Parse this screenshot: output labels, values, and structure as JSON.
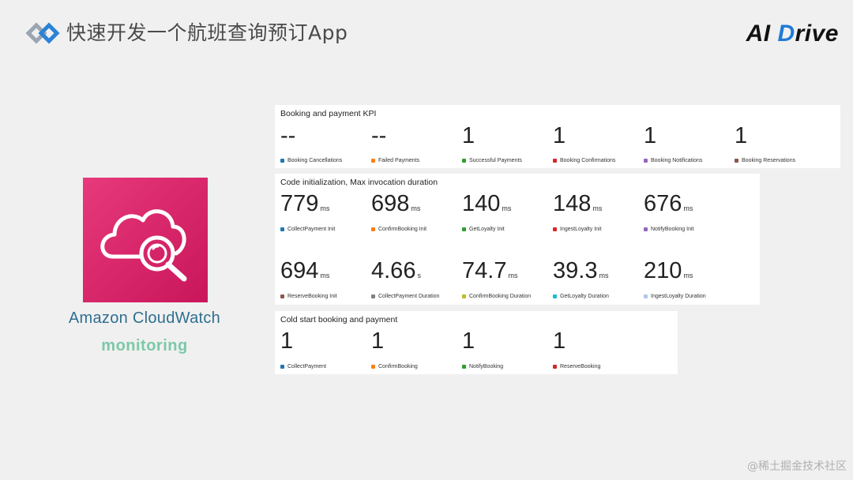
{
  "header": {
    "title": "快速开发一个航班查询预订App",
    "brand_left": "AI ",
    "brand_d": "D",
    "brand_right": "rive"
  },
  "service": {
    "name": "Amazon CloudWatch",
    "subtitle": "monitoring",
    "tile_icon": "cloudwatch-icon"
  },
  "panels": {
    "kpi": {
      "title": "Booking and payment KPI",
      "metrics": [
        {
          "value": "--",
          "unit": "",
          "label": "Booking Cancellations",
          "color": "#1f78b4"
        },
        {
          "value": "--",
          "unit": "",
          "label": "Failed Payments",
          "color": "#ff7f0e"
        },
        {
          "value": "1",
          "unit": "",
          "label": "Successful Payments",
          "color": "#2ca02c"
        },
        {
          "value": "1",
          "unit": "",
          "label": "Booking Confirmations",
          "color": "#d62728"
        },
        {
          "value": "1",
          "unit": "",
          "label": "Booking Notifications",
          "color": "#9467bd"
        },
        {
          "value": "1",
          "unit": "",
          "label": "Booking Reservations",
          "color": "#8c564b"
        }
      ]
    },
    "init": {
      "title": "Code initialization, Max invocation duration",
      "row1": [
        {
          "value": "779",
          "unit": "ms",
          "label": "CollectPayment Init",
          "color": "#1f78b4"
        },
        {
          "value": "698",
          "unit": "ms",
          "label": "ConfirmBooking Init",
          "color": "#ff7f0e"
        },
        {
          "value": "140",
          "unit": "ms",
          "label": "GetLoyalty Init",
          "color": "#2ca02c"
        },
        {
          "value": "148",
          "unit": "ms",
          "label": "IngestLoyalty Init",
          "color": "#d62728"
        },
        {
          "value": "676",
          "unit": "ms",
          "label": "NotifyBooking Init",
          "color": "#9467bd"
        }
      ],
      "row2": [
        {
          "value": "694",
          "unit": "ms",
          "label": "ReserveBooking Init",
          "color": "#8c564b"
        },
        {
          "value": "4.66",
          "unit": "s",
          "label": "CollectPayment Duration",
          "color": "#7f7f7f"
        },
        {
          "value": "74.7",
          "unit": "ms",
          "label": "ConfirmBooking Duration",
          "color": "#bcbd22"
        },
        {
          "value": "39.3",
          "unit": "ms",
          "label": "GetLoyalty Duration",
          "color": "#17becf"
        },
        {
          "value": "210",
          "unit": "ms",
          "label": "IngestLoyalty Duration",
          "color": "#aec7e8"
        }
      ]
    },
    "cold": {
      "title": "Cold start booking and payment",
      "metrics": [
        {
          "value": "1",
          "unit": "",
          "label": "CollectPayment",
          "color": "#1f78b4"
        },
        {
          "value": "1",
          "unit": "",
          "label": "ConfirmBooking",
          "color": "#ff7f0e"
        },
        {
          "value": "1",
          "unit": "",
          "label": "NotifyBooking",
          "color": "#2ca02c"
        },
        {
          "value": "1",
          "unit": "",
          "label": "ReserveBooking",
          "color": "#d62728"
        }
      ]
    }
  },
  "watermark": "@稀土掘金技术社区"
}
